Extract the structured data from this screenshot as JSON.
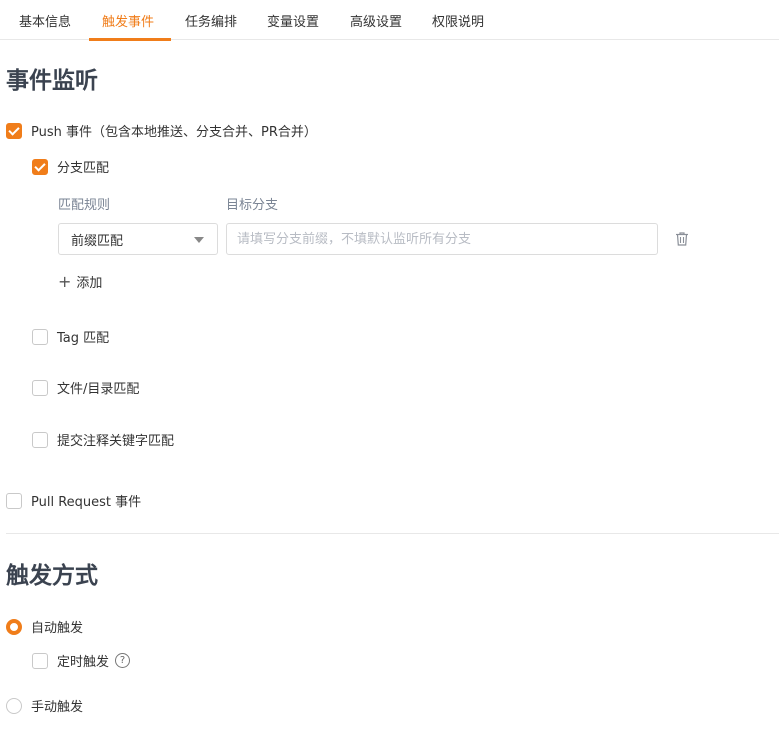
{
  "tabs": {
    "basic": "基本信息",
    "trigger": "触发事件",
    "tasks": "任务编排",
    "variables": "变量设置",
    "advanced": "高级设置",
    "permissions": "权限说明"
  },
  "event_listen": {
    "title": "事件监听",
    "push_event": {
      "label": "Push 事件（包含本地推送、分支合并、PR合并）",
      "checked": true
    },
    "branch_match": {
      "label": "分支匹配",
      "checked": true,
      "rule_label": "匹配规则",
      "target_label": "目标分支",
      "rule_value": "前缀匹配",
      "target_placeholder": "请填写分支前缀，不填默认监听所有分支",
      "add_label": "添加"
    },
    "tag_match": {
      "label": "Tag 匹配",
      "checked": false
    },
    "file_match": {
      "label": "文件/目录匹配",
      "checked": false
    },
    "commit_match": {
      "label": "提交注释关键字匹配",
      "checked": false
    },
    "pull_request": {
      "label": "Pull Request 事件",
      "checked": false
    }
  },
  "trigger_mode": {
    "title": "触发方式",
    "auto": {
      "label": "自动触发",
      "selected": true
    },
    "scheduled": {
      "label": "定时触发",
      "checked": false
    },
    "manual": {
      "label": "手动触发",
      "selected": false
    }
  },
  "colors": {
    "accent": "#f07d1a",
    "title": "#3b4350",
    "muted": "#7a8494"
  }
}
